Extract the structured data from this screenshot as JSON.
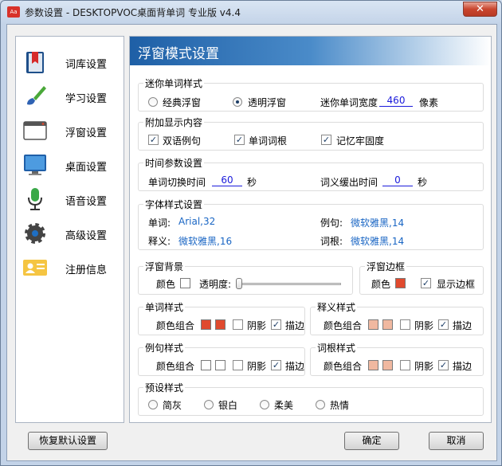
{
  "window": {
    "title": "参数设置 - DESKTOPVOC桌面背单词 专业版 v4.4",
    "app_icon_text": "Aa",
    "close_symbol": "✕"
  },
  "nav": {
    "items": [
      {
        "label": "词库设置",
        "icon": "bookmark-book-icon"
      },
      {
        "label": "学习设置",
        "icon": "brush-icon"
      },
      {
        "label": "浮窗设置",
        "icon": "window-icon"
      },
      {
        "label": "桌面设置",
        "icon": "monitor-icon"
      },
      {
        "label": "语音设置",
        "icon": "microphone-icon"
      },
      {
        "label": "高级设置",
        "icon": "gear-icon"
      },
      {
        "label": "注册信息",
        "icon": "id-card-icon"
      }
    ]
  },
  "panel": {
    "banner_title": "浮窗模式设置",
    "mini_style": {
      "title": "迷你单词样式",
      "opt1": "经典浮窗",
      "opt2": "透明浮窗",
      "selected": "透明浮窗",
      "width_label": "迷你单词宽度",
      "width_value": "460",
      "width_unit": "像素"
    },
    "extra": {
      "title": "附加显示内容",
      "c1": "双语例句",
      "c2": "单词词根",
      "c3": "记忆牢固度"
    },
    "timing": {
      "title": "时间参数设置",
      "switch_label": "单词切换时间",
      "switch_value": "60",
      "switch_unit": "秒",
      "delay_label": "词义缓出时间",
      "delay_value": "0",
      "delay_unit": "秒"
    },
    "font": {
      "title": "字体样式设置",
      "word_label": "单词:",
      "word_value": "Arial,32",
      "example_label": "例句:",
      "example_value": "微软雅黑,14",
      "meaning_label": "释义:",
      "meaning_value": "微软雅黑,16",
      "root_label": "词根:",
      "root_value": "微软雅黑,14"
    },
    "bg": {
      "title": "浮窗背景",
      "color_label": "颜色",
      "opacity_label": "透明度:",
      "opacity_value": 0.0,
      "color": "#ffffff"
    },
    "border": {
      "title": "浮窗边框",
      "color_label": "颜色",
      "show_label": "显示边框",
      "color": "#e04a2e"
    },
    "word_style": {
      "title": "单词样式",
      "combo": "颜色组合",
      "shadow": "阴影",
      "stroke": "描边",
      "c1": "#e04a2e",
      "c2": "#e04a2e"
    },
    "meaning_style": {
      "title": "释义样式",
      "combo": "颜色组合",
      "shadow": "阴影",
      "stroke": "描边",
      "c1": "#f0b8a0",
      "c2": "#f0b8a0"
    },
    "example_style": {
      "title": "例句样式",
      "combo": "颜色组合",
      "shadow": "阴影",
      "stroke": "描边",
      "c1": "#ffffff",
      "c2": "#ffffff"
    },
    "root_style": {
      "title": "词根样式",
      "combo": "颜色组合",
      "shadow": "阴影",
      "stroke": "描边",
      "c1": "#f0b8a0",
      "c2": "#f0b8a0"
    },
    "preset": {
      "title": "预设样式",
      "o1": "简灰",
      "o2": "银白",
      "o3": "柔美",
      "o4": "热情"
    }
  },
  "buttons": {
    "reset": "恢复默认设置",
    "ok": "确定",
    "cancel": "取消"
  },
  "check_mark": "✓"
}
